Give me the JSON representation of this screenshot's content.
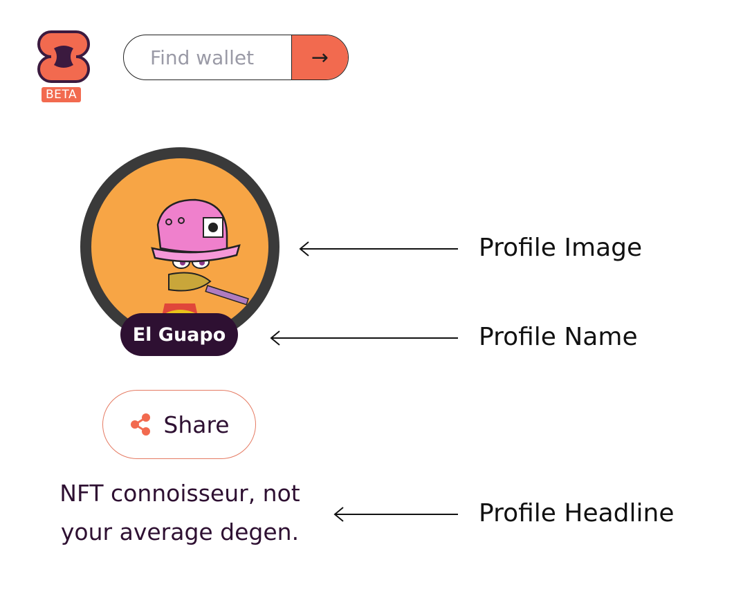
{
  "header": {
    "beta_badge": "BETA",
    "search": {
      "placeholder": "Find wallet",
      "value": ""
    }
  },
  "profile": {
    "name": "El Guapo",
    "share_label": "Share",
    "headline_line1": "NFT connoisseur, not",
    "headline_line2": "your average degen."
  },
  "annotations": {
    "image": "Profile Image",
    "name": "Profile Name",
    "headline": "Profile Headline"
  },
  "icons": {
    "logo": "logo-icon",
    "search_submit": "arrow-right-icon",
    "share": "share-icon"
  },
  "colors": {
    "accent": "#f26a4f",
    "dark_purple": "#2e1032",
    "avatar_bg": "#f7a545",
    "avatar_ring": "#3a3a3a"
  }
}
